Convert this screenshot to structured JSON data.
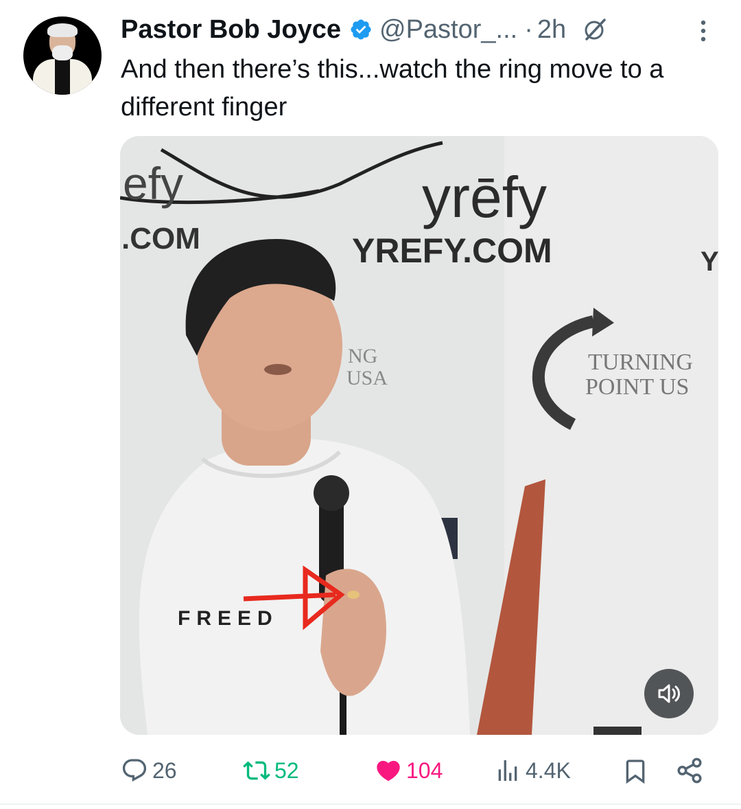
{
  "post": {
    "author_name": "Pastor Bob Joyce",
    "handle": "@Pastor_...",
    "separator": "·",
    "time": "2h",
    "text": "And then there’s this...watch the ring move to a different finger"
  },
  "media": {
    "type": "video",
    "backdrop_texts": [
      "efy",
      ".COM",
      "yrēfy",
      "YREFY.COM",
      "Y",
      "NG",
      "USA",
      "TURNING",
      "POINT US"
    ],
    "shirt_text": "FREED"
  },
  "actions": {
    "replies": "26",
    "reposts": "52",
    "likes": "104",
    "views": "4.4K"
  },
  "icons": [
    "verified-badge-icon",
    "grok-icon",
    "more-icon",
    "sound-icon",
    "reply-icon",
    "repost-icon",
    "like-icon",
    "views-icon",
    "bookmark-icon",
    "share-icon"
  ],
  "colors": {
    "verified": "#1d9bf0",
    "repost": "#00ba7c",
    "like": "#f91880",
    "secondary": "#536471"
  }
}
